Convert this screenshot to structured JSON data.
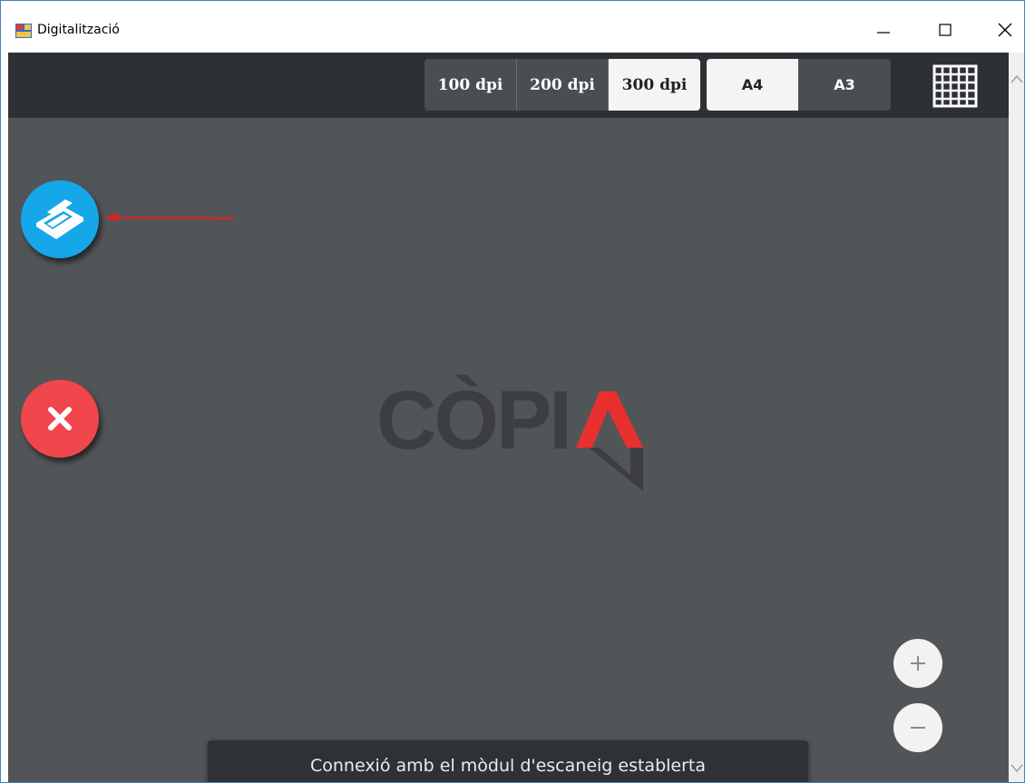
{
  "window": {
    "title": "Digitalització",
    "controls": [
      "minimize",
      "maximize",
      "close"
    ]
  },
  "toolbar": {
    "resolution_options": [
      {
        "label": "100 dpi",
        "selected": false
      },
      {
        "label": "200 dpi",
        "selected": false
      },
      {
        "label": "300 dpi",
        "selected": true
      }
    ],
    "paper_options": [
      {
        "label": "A4",
        "selected": true
      },
      {
        "label": "A3",
        "selected": false
      }
    ],
    "grid_icon": "grid-icon"
  },
  "actions": {
    "scan_icon": "scanner-icon",
    "cancel_icon": "close-icon"
  },
  "logo": {
    "text": "CÒPI",
    "accent": "#e8302e"
  },
  "zoom": {
    "in_symbol": "+",
    "out_symbol": "−"
  },
  "toast": {
    "message": "Connexió amb el mòdul d'escaneig establerta"
  },
  "colors": {
    "scan_button": "#16a6ea",
    "cancel_button": "#f0464c",
    "toolbar_bg": "#2d3034",
    "canvas_bg": "#525558",
    "annotation_arrow": "#e02020"
  }
}
